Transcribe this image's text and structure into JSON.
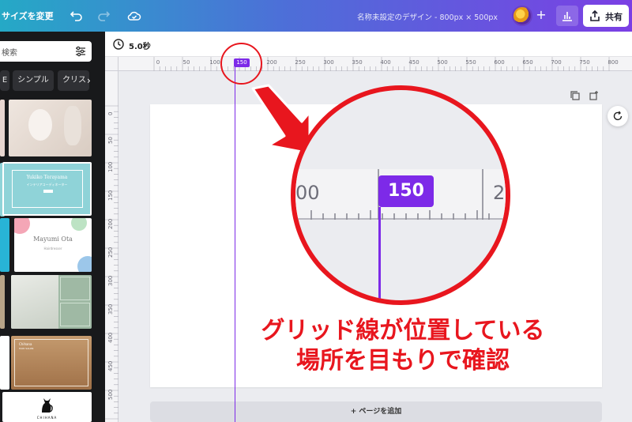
{
  "topbar": {
    "resize_label": "サイズを変更",
    "design_title": "名称未設定のデザイン - 800px × 500px",
    "share_label": "共有",
    "plus_label": "+"
  },
  "leftpanel": {
    "search_placeholder": "検索",
    "chips": [
      "E",
      "シンプル",
      "クリス"
    ]
  },
  "timebar": {
    "duration": "5.0秒"
  },
  "ruler": {
    "h_ticks": [
      "0",
      "50",
      "100",
      "150",
      "200",
      "250",
      "300",
      "350",
      "400",
      "450",
      "500",
      "550",
      "600",
      "650",
      "700",
      "750",
      "800"
    ],
    "v_ticks": [
      "0",
      "50",
      "100",
      "150",
      "200",
      "250",
      "300",
      "350",
      "400",
      "450",
      "500"
    ],
    "marker": "150"
  },
  "zoom": {
    "left_label": "00",
    "marker": "150",
    "right_label": "2"
  },
  "canvas": {
    "add_page": "+ ページを追加"
  },
  "annotation": {
    "line1": "グリッド線が位置している",
    "line2": "場所を目もりで確認"
  },
  "colors": {
    "accent": "#7d2ae8",
    "annotation_red": "#e8161e"
  },
  "templates": [
    {
      "name": "Yukiko Terayama",
      "subtitle": "インテリアコーディネーター"
    },
    {
      "name": "Mayumi Ota",
      "subtitle": "Hairdresser"
    },
    {
      "name": "Chihana",
      "subtitle": "HAIR SALON"
    },
    {
      "name": "CHIHANA",
      "subtitle": "MASSAGE"
    }
  ]
}
